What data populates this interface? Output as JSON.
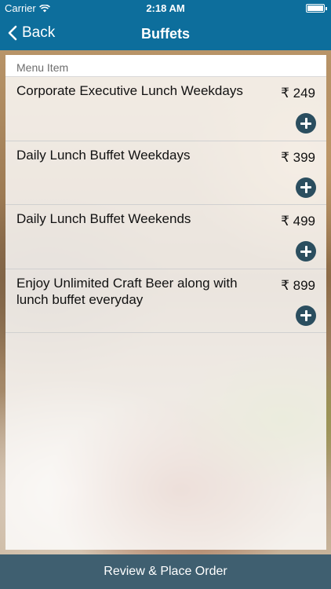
{
  "status_bar": {
    "carrier": "Carrier",
    "time": "2:18 AM",
    "battery_level": 1.0
  },
  "nav": {
    "back_label": "Back",
    "title": "Buffets",
    "bar_color": "#0d6e9c"
  },
  "list": {
    "header": "Menu Item",
    "items": [
      {
        "name": "Corporate Executive Lunch Weekdays",
        "price": "₹ 249"
      },
      {
        "name": "Daily Lunch Buffet Weekdays",
        "price": "₹ 399"
      },
      {
        "name": "Daily Lunch Buffet Weekends",
        "price": "₹ 499"
      },
      {
        "name": "Enjoy Unlimited Craft Beer along with lunch buffet everyday",
        "price": "₹ 899"
      }
    ],
    "add_icon": "plus-circle-icon"
  },
  "footer": {
    "order_label": "Review & Place Order",
    "button_color": "#3f5f70"
  }
}
